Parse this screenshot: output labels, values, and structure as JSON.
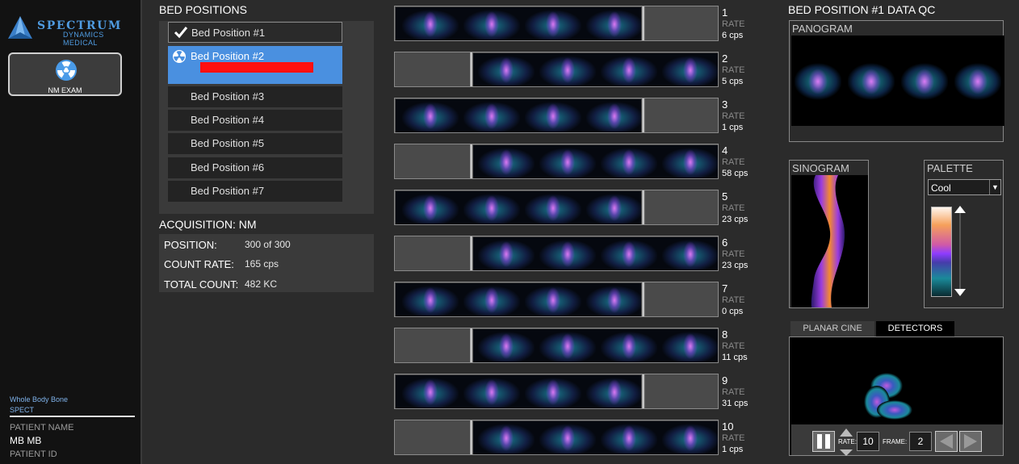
{
  "brand": {
    "name": "SPECTRUM",
    "subtitle": "DYNAMICS MEDICAL"
  },
  "nav": {
    "nm_exam_label": "NM EXAM"
  },
  "study": {
    "name": "Whole Body Bone",
    "type": "SPECT"
  },
  "patient": {
    "name_label": "PATIENT NAME",
    "name": "MB MB",
    "id_label": "PATIENT ID"
  },
  "bed_positions": {
    "title": "BED POSITIONS",
    "items": [
      {
        "label": "Bed Position #1",
        "state": "done"
      },
      {
        "label": "Bed Position #2",
        "state": "active"
      },
      {
        "label": "Bed Position #3",
        "state": "pending"
      },
      {
        "label": "Bed Position #4",
        "state": "pending"
      },
      {
        "label": "Bed Position #5",
        "state": "pending"
      },
      {
        "label": "Bed Position #6",
        "state": "pending"
      },
      {
        "label": "Bed Position #7",
        "state": "pending"
      }
    ]
  },
  "acquisition": {
    "title": "ACQUISITION: NM",
    "position_label": "POSITION:",
    "position_value": "300 of 300",
    "count_rate_label": "COUNT RATE:",
    "count_rate_value": "165 cps",
    "total_count_label": "TOTAL COUNT:",
    "total_count_value": "482 KC"
  },
  "detectors": {
    "rate_label": "RATE",
    "items": [
      {
        "num": "1",
        "cps": "6 cps",
        "side": "left"
      },
      {
        "num": "2",
        "cps": "5 cps",
        "side": "right"
      },
      {
        "num": "3",
        "cps": "1 cps",
        "side": "left"
      },
      {
        "num": "4",
        "cps": "58 cps",
        "side": "right"
      },
      {
        "num": "5",
        "cps": "23 cps",
        "side": "left"
      },
      {
        "num": "6",
        "cps": "23 cps",
        "side": "right"
      },
      {
        "num": "7",
        "cps": "0 cps",
        "side": "left"
      },
      {
        "num": "8",
        "cps": "11 cps",
        "side": "right"
      },
      {
        "num": "9",
        "cps": "31 cps",
        "side": "left"
      },
      {
        "num": "10",
        "cps": "1 cps",
        "side": "right"
      }
    ]
  },
  "qc": {
    "title": "BED POSITION #1 DATA QC",
    "panogram_label": "PANOGRAM",
    "sinogram_label": "SINOGRAM",
    "palette_label": "PALETTE",
    "palette_value": "Cool",
    "tabs": {
      "planar_cine": "PLANAR CINE",
      "detectors": "DETECTORS"
    },
    "cine": {
      "rate_label": "RATE:",
      "rate_value": "10",
      "frame_label": "FRAME:",
      "frame_value": "2"
    }
  }
}
